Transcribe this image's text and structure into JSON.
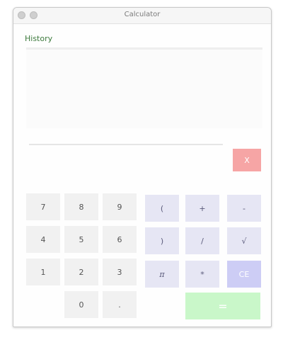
{
  "window": {
    "title": "Calculator"
  },
  "history": {
    "label": "History"
  },
  "display": {
    "value": "",
    "placeholder": ""
  },
  "clear_button": {
    "label": "X"
  },
  "keys": {
    "k7": "7",
    "k8": "8",
    "k9": "9",
    "k4": "4",
    "k5": "5",
    "k6": "6",
    "k1": "1",
    "k2": "2",
    "k3": "3",
    "k0": "0",
    "dot": ".",
    "lparen": "(",
    "plus": "+",
    "minus": "-",
    "rparen": ")",
    "divide": "/",
    "sqrt": "√",
    "pi": "π",
    "multiply": "*",
    "ce": "CE",
    "equals": "="
  },
  "colors": {
    "history_label": "#3d7a3d",
    "clear_button": "#f6a5a5",
    "number_key": "#f1f1f1",
    "operator_key": "#e6e6f4",
    "ce_key": "#cdcdf5",
    "equals_key": "#c9f7c9"
  }
}
